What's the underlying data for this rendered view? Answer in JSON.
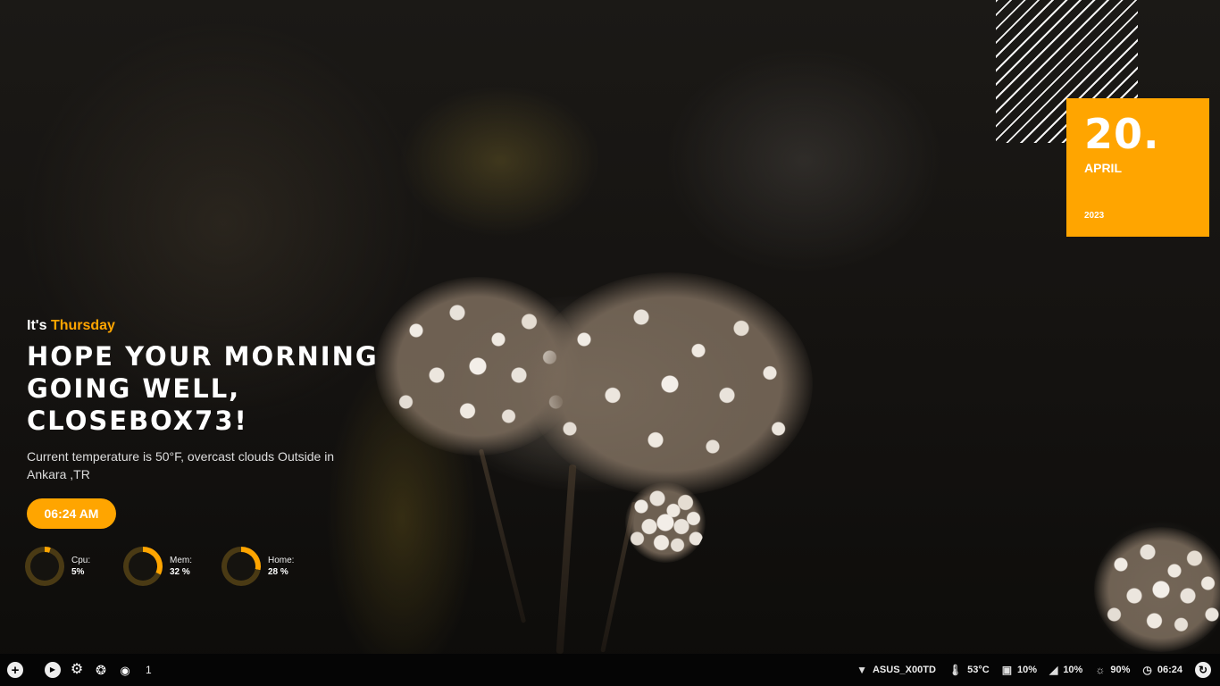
{
  "colors": {
    "accent": "#ffa500",
    "taskbar": "#050505",
    "text": "#ffffff"
  },
  "calendar": {
    "day": "20.",
    "month": "APRIL",
    "year": "2023"
  },
  "greeting": {
    "prefix": "It's",
    "day": "Thursday",
    "headline_line1": "Hope your morning",
    "headline_line2": "going well,",
    "headline_line3": "Closebox73!",
    "weather": "Current temperature is 50°F, overcast clouds Outside in Ankara ,TR"
  },
  "clock": {
    "time": "06:24 AM"
  },
  "stats": [
    {
      "label": "Cpu:",
      "value": "5%",
      "percent": 5
    },
    {
      "label": "Mem:",
      "value": "32 %",
      "percent": 32
    },
    {
      "label": "Home:",
      "value": "28 %",
      "percent": 28
    }
  ],
  "taskbar": {
    "left_icons": [
      "add-icon",
      "play-icon",
      "gear-icon",
      "aperture-icon",
      "palette-icon"
    ],
    "workspace": "1",
    "wifi": {
      "icon": "wifi-icon",
      "label": "ASUS_X00TD"
    },
    "temp": {
      "icon": "thermometer-icon",
      "label": "53°C"
    },
    "cpu": {
      "icon": "chip-icon",
      "label": "10%"
    },
    "volume": {
      "icon": "volume-icon",
      "label": "10%"
    },
    "brightness": {
      "icon": "brightness-icon",
      "label": "90%"
    },
    "clock": {
      "icon": "clock-icon",
      "label": "06:24"
    },
    "power": {
      "icon": "power-icon"
    }
  }
}
